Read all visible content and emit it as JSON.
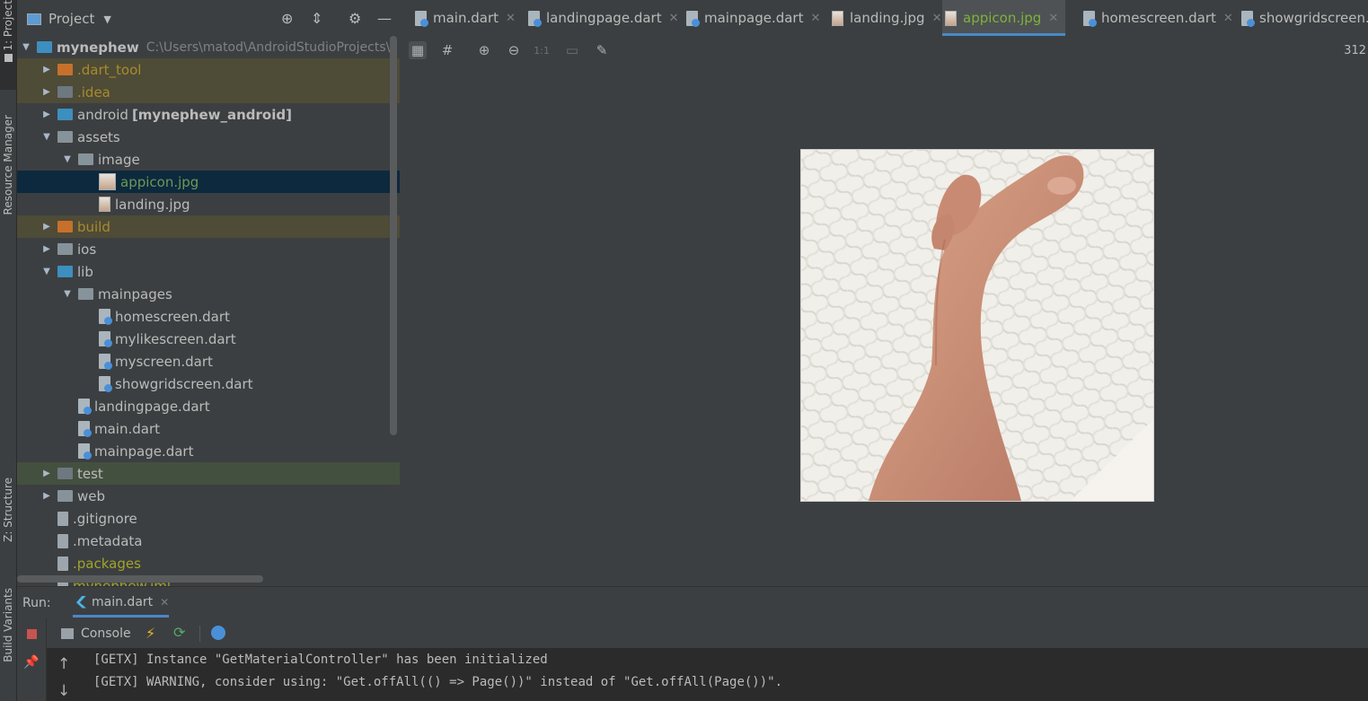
{
  "side_tabs": {
    "project": "1: Project",
    "resource_manager": "Resource Manager",
    "structure": "Z: Structure",
    "build_variants": "Build Variants"
  },
  "project_panel": {
    "title": "Project",
    "tree": [
      {
        "label": "mynephew",
        "extra": "",
        "path": "C:\\Users\\matod\\AndroidStudioProjects\\",
        "type": "root",
        "icon": "folder-module-icon"
      },
      {
        "label": ".dart_tool",
        "extra": "",
        "path": "",
        "type": "folder",
        "icon": "folder-excluded-icon"
      },
      {
        "label": ".idea",
        "extra": "",
        "path": "",
        "type": "folder",
        "icon": "folder-settings-icon"
      },
      {
        "label": "android",
        "extra": "[mynephew_android]",
        "path": "",
        "type": "folder",
        "icon": "folder-module-icon"
      },
      {
        "label": "assets",
        "extra": "",
        "path": "",
        "type": "folder",
        "icon": "folder-icon"
      },
      {
        "label": "image",
        "extra": "",
        "path": "",
        "type": "folder",
        "icon": "folder-icon"
      },
      {
        "label": "appicon.jpg",
        "extra": "",
        "path": "",
        "type": "image",
        "icon": "image-file-icon"
      },
      {
        "label": "landing.jpg",
        "extra": "",
        "path": "",
        "type": "image",
        "icon": "image-file-icon"
      },
      {
        "label": "build",
        "extra": "",
        "path": "",
        "type": "folder",
        "icon": "folder-excluded-icon"
      },
      {
        "label": "ios",
        "extra": "",
        "path": "",
        "type": "folder",
        "icon": "folder-icon"
      },
      {
        "label": "lib",
        "extra": "",
        "path": "",
        "type": "folder",
        "icon": "folder-source-icon"
      },
      {
        "label": "mainpages",
        "extra": "",
        "path": "",
        "type": "folder",
        "icon": "package-icon"
      },
      {
        "label": "homescreen.dart",
        "extra": "",
        "path": "",
        "type": "dart",
        "icon": "dart-file-icon"
      },
      {
        "label": "mylikescreen.dart",
        "extra": "",
        "path": "",
        "type": "dart",
        "icon": "dart-file-icon"
      },
      {
        "label": "myscreen.dart",
        "extra": "",
        "path": "",
        "type": "dart",
        "icon": "dart-file-icon"
      },
      {
        "label": "showgridscreen.dart",
        "extra": "",
        "path": "",
        "type": "dart",
        "icon": "dart-file-icon"
      },
      {
        "label": "landingpage.dart",
        "extra": "",
        "path": "",
        "type": "dart",
        "icon": "dart-file-icon"
      },
      {
        "label": "main.dart",
        "extra": "",
        "path": "",
        "type": "dart",
        "icon": "dart-file-icon"
      },
      {
        "label": "mainpage.dart",
        "extra": "",
        "path": "",
        "type": "dart",
        "icon": "dart-file-icon"
      },
      {
        "label": "test",
        "extra": "",
        "path": "",
        "type": "folder",
        "icon": "folder-test-icon"
      },
      {
        "label": "web",
        "extra": "",
        "path": "",
        "type": "folder",
        "icon": "folder-icon"
      },
      {
        "label": ".gitignore",
        "extra": "",
        "path": "",
        "type": "file",
        "icon": "ignore-file-icon"
      },
      {
        "label": ".metadata",
        "extra": "",
        "path": "",
        "type": "file",
        "icon": "text-file-icon"
      },
      {
        "label": ".packages",
        "extra": "",
        "path": "",
        "type": "file",
        "icon": "text-file-icon"
      },
      {
        "label": "mynephew.iml",
        "extra": "",
        "path": "",
        "type": "file",
        "icon": "module-file-icon"
      }
    ]
  },
  "editor_tabs": [
    {
      "label": "main.dart",
      "icon": "dart-file-icon",
      "active": false
    },
    {
      "label": "landingpage.dart",
      "icon": "dart-file-icon",
      "active": false
    },
    {
      "label": "mainpage.dart",
      "icon": "dart-file-icon",
      "active": false
    },
    {
      "label": "landing.jpg",
      "icon": "image-file-icon",
      "active": false
    },
    {
      "label": "appicon.jpg",
      "icon": "image-file-icon",
      "active": true
    },
    {
      "label": "homescreen.dart",
      "icon": "dart-file-icon",
      "active": false
    },
    {
      "label": "showgridscreen.da",
      "icon": "dart-file-icon",
      "active": false
    }
  ],
  "viewer": {
    "readout": "312",
    "image_name": "appicon.jpg"
  },
  "run_panel": {
    "label": "Run:",
    "tab": "main.dart",
    "console_tab": "Console",
    "lines": [
      "[GETX] Instance \"GetMaterialController\" has been initialized",
      "[GETX] WARNING, consider using: \"Get.offAll(() => Page())\" instead of \"Get.offAll(Page())\"."
    ]
  },
  "colors": {
    "accent_active_tab": "#7eb23a",
    "selection": "#0d293e",
    "excluded_highlight": "#4e4b37",
    "test_highlight": "#44503f"
  }
}
